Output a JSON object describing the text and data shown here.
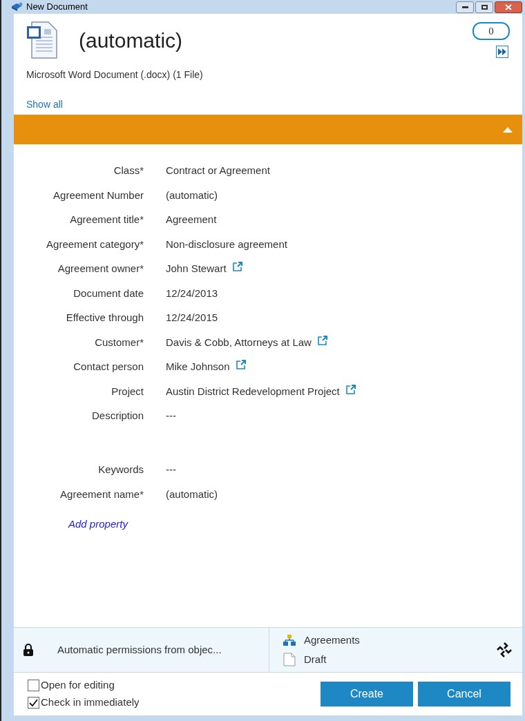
{
  "window": {
    "title": "New Document"
  },
  "header": {
    "title": "(automatic)",
    "file_type": "Microsoft Word Document (.docx) (1 File)",
    "comment_count": "0",
    "show_all": "Show all"
  },
  "section": {
    "expanded": true
  },
  "properties": [
    {
      "label": "Class*",
      "value": "Contract or Agreement",
      "link": false,
      "multiline": false
    },
    {
      "label": "Agreement Number",
      "value": "(automatic)",
      "link": false,
      "multiline": false
    },
    {
      "label": "Agreement title*",
      "value": "Agreement",
      "link": false,
      "multiline": false
    },
    {
      "label": "Agreement category*",
      "value": "Non-disclosure agreement",
      "link": false,
      "multiline": false
    },
    {
      "label": "Agreement owner*",
      "value": "John Stewart",
      "link": true,
      "multiline": false
    },
    {
      "label": "Document date",
      "value": "12/24/2013",
      "link": false,
      "multiline": false
    },
    {
      "label": "Effective through",
      "value": "12/24/2015",
      "link": false,
      "multiline": false
    },
    {
      "label": "Customer*",
      "value": "Davis & Cobb, Attorneys at Law",
      "link": true,
      "multiline": false
    },
    {
      "label": "Contact person",
      "value": "Mike Johnson",
      "link": true,
      "multiline": false
    },
    {
      "label": "Project",
      "value": "Austin District Redevelopment Project",
      "link": true,
      "multiline": false
    },
    {
      "label": "Description",
      "value": "---",
      "link": false,
      "multiline": true
    },
    {
      "label": "Keywords",
      "value": "---",
      "link": false,
      "multiline": false
    },
    {
      "label": "Agreement name*",
      "value": "(automatic)",
      "link": false,
      "multiline": false
    }
  ],
  "add_property": "Add property",
  "permissions": "Automatic permissions from objec...",
  "workflow": "Agreements",
  "state": "Draft",
  "options": [
    {
      "label": "Open for editing",
      "checked": false
    },
    {
      "label": "Check in immediately",
      "checked": true
    }
  ],
  "buttons": [
    "Create",
    "Cancel"
  ]
}
